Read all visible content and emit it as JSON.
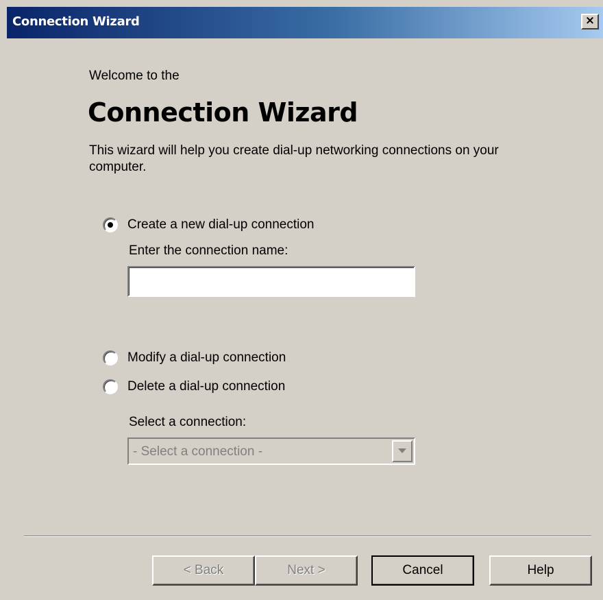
{
  "window": {
    "title": "Connection Wizard",
    "close_label": "×"
  },
  "content": {
    "welcome": "Welcome to the",
    "heading": "Connection Wizard",
    "description": "This wizard will help you create dial-up networking connections on your computer."
  },
  "options": {
    "create_label": "Create a new dial-up connection",
    "create_checked": true,
    "name_label": "Enter the connection name:",
    "name_value": "",
    "modify_label": "Modify a dial-up connection",
    "modify_checked": false,
    "delete_label": "Delete a dial-up connection",
    "delete_checked": false,
    "select_label": "Select a connection:",
    "select_value": "- Select a connection -",
    "select_enabled": false
  },
  "buttons": {
    "back": "< Back",
    "next": "Next >",
    "cancel": "Cancel",
    "help": "Help"
  },
  "icons": {
    "close": "close-icon",
    "radio_selected": "radio-selected-icon",
    "radio_unselected": "radio-unselected-icon",
    "dropdown": "chevron-down-icon"
  },
  "colors": {
    "titlebar_start": "#0a246a",
    "titlebar_end": "#a6caf0",
    "dialog_bg": "#d4d0c8",
    "disabled_text": "#808080"
  }
}
